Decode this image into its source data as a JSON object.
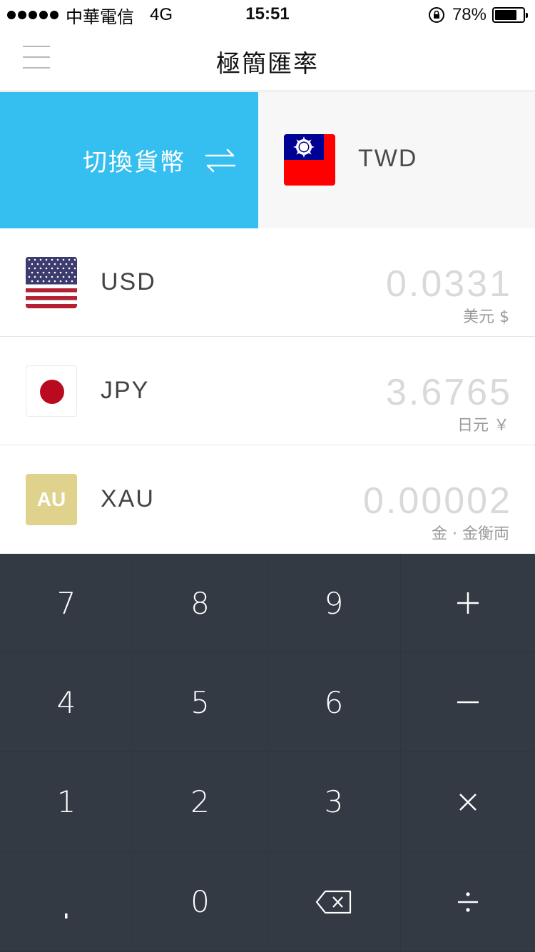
{
  "status_bar": {
    "carrier": "中華電信",
    "network": "4G",
    "time": "15:51",
    "battery": "78%",
    "battery_level": 0.78
  },
  "header": {
    "title": "極簡匯率"
  },
  "switch": {
    "label": "切換貨幣",
    "icon": "swap-arrows-icon",
    "base_currency": "TWD",
    "base_flag": "taiwan-flag-icon"
  },
  "currencies": [
    {
      "code": "USD",
      "value": "0.0331",
      "name": "美元 $",
      "flag": "usa-flag-icon"
    },
    {
      "code": "JPY",
      "value": "3.6765",
      "name": "日元 ￥",
      "flag": "japan-flag-icon"
    },
    {
      "code": "XAU",
      "value": "0.00002",
      "name": "金 · 金衡両",
      "flag": "gold-au-icon",
      "badge": "AU"
    }
  ],
  "keypad": {
    "keys": [
      "7",
      "8",
      "9",
      "+",
      "4",
      "5",
      "6",
      "−",
      "1",
      "2",
      "3",
      "×",
      ".",
      "0",
      "backspace",
      "÷"
    ]
  },
  "colors": {
    "accent": "#35bff0",
    "keypad_bg": "#333a44",
    "gold": "#dfd28c"
  }
}
